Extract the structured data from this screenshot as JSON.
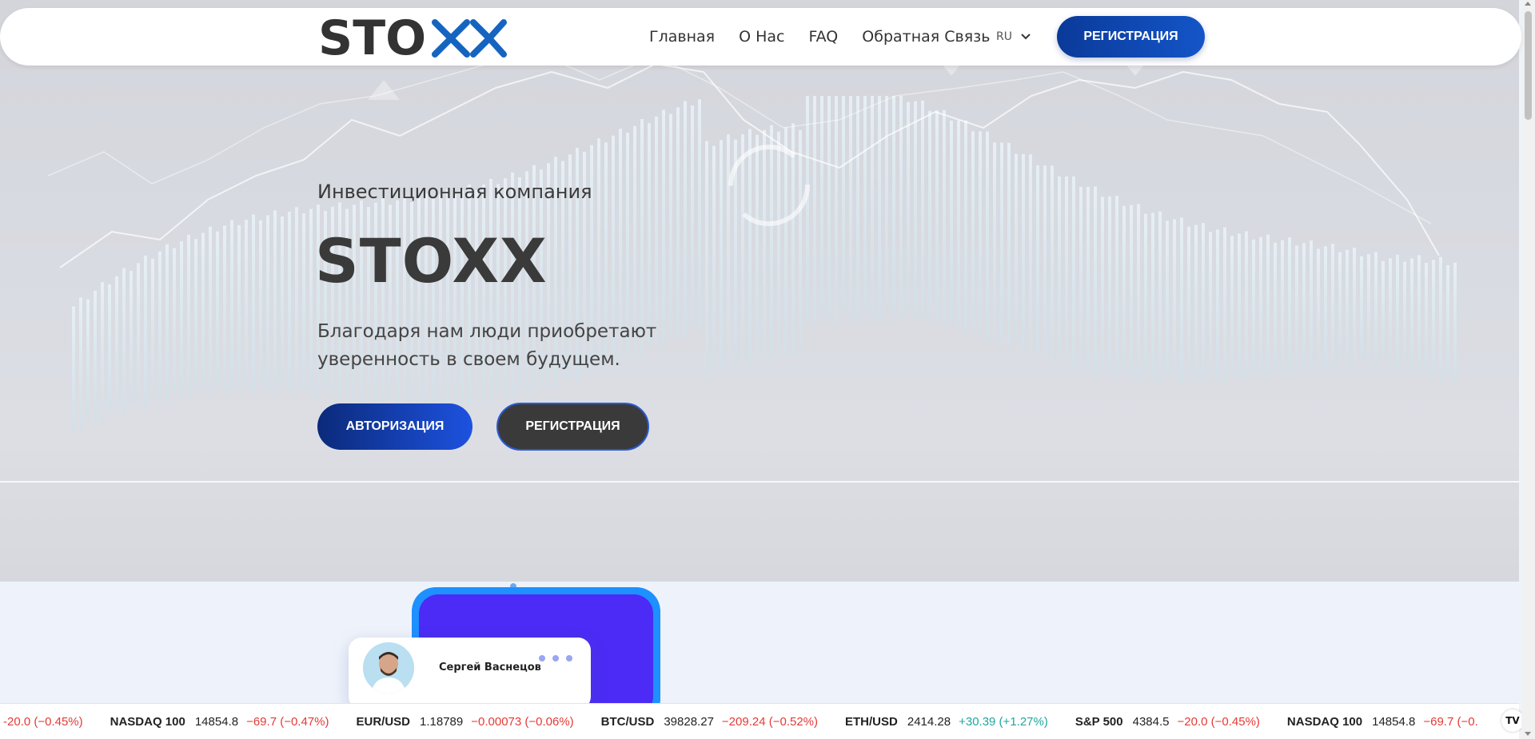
{
  "nav": {
    "logo_text": "STOXX",
    "links": [
      {
        "label": "Главная"
      },
      {
        "label": "О Нас"
      },
      {
        "label": "FAQ"
      },
      {
        "label": "Обратная Связь"
      }
    ],
    "language": "RU",
    "register_label": "РЕГИСТРАЦИЯ"
  },
  "hero": {
    "subtitle": "Инвестиционная компания",
    "title": "STOXX",
    "description": "Благодаря нам люди приобретают уверенность в своем будущем.",
    "login_label": "АВТОРИЗАЦИЯ",
    "register_label": "РЕГИСТРАЦИЯ"
  },
  "profile": {
    "name": "Сергей Васнецов"
  },
  "ticker": [
    {
      "symbol": "",
      "price": "",
      "change": "-20.0 (−0.45%)",
      "dir": "neg"
    },
    {
      "symbol": "NASDAQ 100",
      "price": "14854.8",
      "change": "−69.7 (−0.47%)",
      "dir": "neg"
    },
    {
      "symbol": "EUR/USD",
      "price": "1.18789",
      "change": "−0.00073 (−0.06%)",
      "dir": "neg"
    },
    {
      "symbol": "BTC/USD",
      "price": "39828.27",
      "change": "−209.24 (−0.52%)",
      "dir": "neg"
    },
    {
      "symbol": "ETH/USD",
      "price": "2414.28",
      "change": "+30.39 (+1.27%)",
      "dir": "pos"
    },
    {
      "symbol": "S&P 500",
      "price": "4384.5",
      "change": "−20.0 (−0.45%)",
      "dir": "neg"
    },
    {
      "symbol": "NASDAQ 100",
      "price": "14854.8",
      "change": "−69.7 (−0.",
      "dir": "neg"
    }
  ],
  "colors": {
    "brand_blue": "#1455c8",
    "dark_button": "#3a3a3a",
    "negative": "#e53935",
    "positive": "#1ea7a0"
  },
  "icons": {
    "language_dropdown": "chevron-down-icon",
    "ticker_brand": "tradingview-logo"
  }
}
